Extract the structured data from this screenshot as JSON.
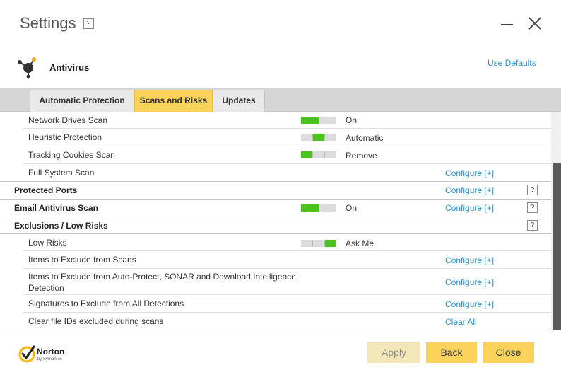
{
  "window": {
    "title": "Settings",
    "help": "?"
  },
  "header": {
    "title": "Antivirus",
    "use_defaults": "Use Defaults"
  },
  "tabs": [
    {
      "label": "Automatic Protection",
      "selected": false
    },
    {
      "label": "Scans and Risks",
      "selected": true
    },
    {
      "label": "Updates",
      "selected": false
    }
  ],
  "rows": {
    "network_drives": {
      "label": "Network Drives Scan",
      "value": "On",
      "level": 0.5
    },
    "heuristic": {
      "label": "Heuristic Protection",
      "value": "Automatic",
      "level": "2 of 3"
    },
    "tracking_cookies": {
      "label": "Tracking Cookies Scan",
      "value": "Remove",
      "level": "1 of 3"
    },
    "full_system": {
      "label": "Full System Scan",
      "action": "Configure [+]"
    },
    "protected_ports": {
      "label": "Protected Ports",
      "action": "Configure [+]",
      "help": "?"
    },
    "email_scan": {
      "label": "Email Antivirus Scan",
      "value": "On",
      "level": 0.5,
      "action": "Configure [+]",
      "help": "?"
    },
    "exclusions": {
      "label": "Exclusions / Low Risks",
      "help": "?"
    },
    "low_risks": {
      "label": "Low Risks",
      "value": "Ask Me",
      "level": "3 of 3"
    },
    "items_scans": {
      "label": "Items to Exclude from Scans",
      "action": "Configure [+]"
    },
    "items_autoprotect": {
      "label_line1": "Items to Exclude from Auto-Protect, SONAR and Download Intelligence",
      "label_line2": "Detection",
      "action": "Configure [+]"
    },
    "signatures": {
      "label": "Signatures to Exclude from All Detections",
      "action": "Configure [+]"
    },
    "clear_ids": {
      "label": "Clear file IDs excluded during scans",
      "action": "Clear All"
    }
  },
  "footer": {
    "brand": "Norton",
    "brand_sub": "by Symantec",
    "apply": "Apply",
    "back": "Back",
    "close": "Close"
  },
  "colors": {
    "accent": "#fbd35a",
    "toggle_on": "#4cc21e",
    "link": "#2a8fd0"
  }
}
